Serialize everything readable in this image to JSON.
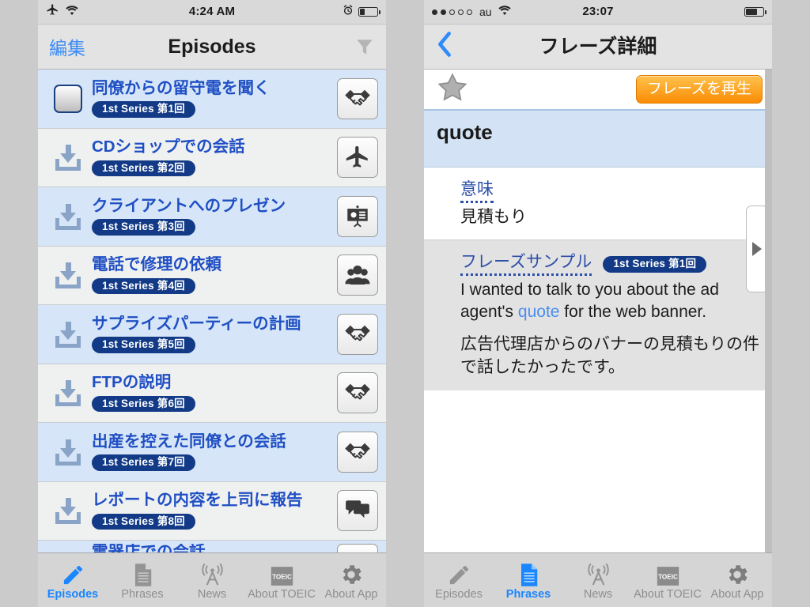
{
  "left": {
    "status": {
      "time": "4:24 AM",
      "airplane_icon": "airplane-icon",
      "wifi_icon": "wifi-icon",
      "alarm_icon": "alarm-clock-icon",
      "battery_level": 30
    },
    "nav": {
      "left_button": "編集",
      "title": "Episodes",
      "right_icon": "filter-funnel-icon"
    },
    "rows": [
      {
        "title": "同僚からの留守電を聞く",
        "badge": "1st Series 第1回",
        "lead": "checkbox",
        "icon": "handshake-icon",
        "selected": true
      },
      {
        "title": "CDショップでの会話",
        "badge": "1st Series 第2回",
        "lead": "download-icon",
        "icon": "airplane-icon",
        "selected": false
      },
      {
        "title": "クライアントへのプレゼン",
        "badge": "1st Series 第3回",
        "lead": "download-icon",
        "icon": "presentation-icon",
        "selected": true
      },
      {
        "title": "電話で修理の依頼",
        "badge": "1st Series 第4回",
        "lead": "download-icon",
        "icon": "people-group-icon",
        "selected": false
      },
      {
        "title": "サプライズパーティーの計画",
        "badge": "1st Series 第5回",
        "lead": "download-icon",
        "icon": "handshake-icon",
        "selected": true
      },
      {
        "title": "FTPの説明",
        "badge": "1st Series 第6回",
        "lead": "download-icon",
        "icon": "handshake-icon",
        "selected": false
      },
      {
        "title": "出産を控えた同僚との会話",
        "badge": "1st Series 第7回",
        "lead": "download-icon",
        "icon": "handshake-icon",
        "selected": true
      },
      {
        "title": "レポートの内容を上司に報告",
        "badge": "1st Series 第8回",
        "lead": "download-icon",
        "icon": "speech-bubbles-icon",
        "selected": false
      },
      {
        "title": "電器店での会話",
        "badge": "",
        "lead": "download-icon",
        "icon": "",
        "selected": true
      }
    ],
    "tabs": [
      {
        "label": "Episodes",
        "icon": "pencil-icon",
        "active": true
      },
      {
        "label": "Phrases",
        "icon": "document-icon",
        "active": false
      },
      {
        "label": "News",
        "icon": "broadcast-tower-icon",
        "active": false
      },
      {
        "label": "About TOEIC",
        "icon": "toeic-badge-icon",
        "active": false
      },
      {
        "label": "About App",
        "icon": "gear-icon",
        "active": false
      }
    ]
  },
  "right": {
    "status": {
      "signal_dots_filled": 2,
      "signal_dots_total": 5,
      "carrier": "au",
      "wifi_icon": "wifi-icon",
      "time": "23:07",
      "battery_level": 62
    },
    "nav": {
      "back_icon": "chevron-left-icon",
      "title": "フレーズ詳細"
    },
    "favorite": {
      "icon": "star-outline-icon",
      "play_button": "フレーズを再生"
    },
    "word": "quote",
    "meaning": {
      "title": "意味",
      "body": "見積もり"
    },
    "sample": {
      "title": "フレーズサンプル",
      "badge": "1st Series 第1回",
      "english_before": "I wanted to talk to you about the ad agent's ",
      "english_highlight": "quote",
      "english_after": " for the web banner.",
      "japanese": "広告代理店からのバナーの見積もりの件で話したかったです。"
    },
    "scroll_next_icon": "play-triangle-icon",
    "tabs": [
      {
        "label": "Episodes",
        "icon": "pencil-icon",
        "active": false
      },
      {
        "label": "Phrases",
        "icon": "document-icon",
        "active": true
      },
      {
        "label": "News",
        "icon": "broadcast-tower-icon",
        "active": false
      },
      {
        "label": "About TOEIC",
        "icon": "toeic-badge-icon",
        "active": false
      },
      {
        "label": "About App",
        "icon": "gear-icon",
        "active": false
      }
    ]
  },
  "theme": {
    "accent_blue": "#1f4fc4",
    "badge_navy": "#123a86",
    "row_selected": "#d6e5f7",
    "orange": "#fa8c05",
    "tab_active": "#1a86ff"
  }
}
